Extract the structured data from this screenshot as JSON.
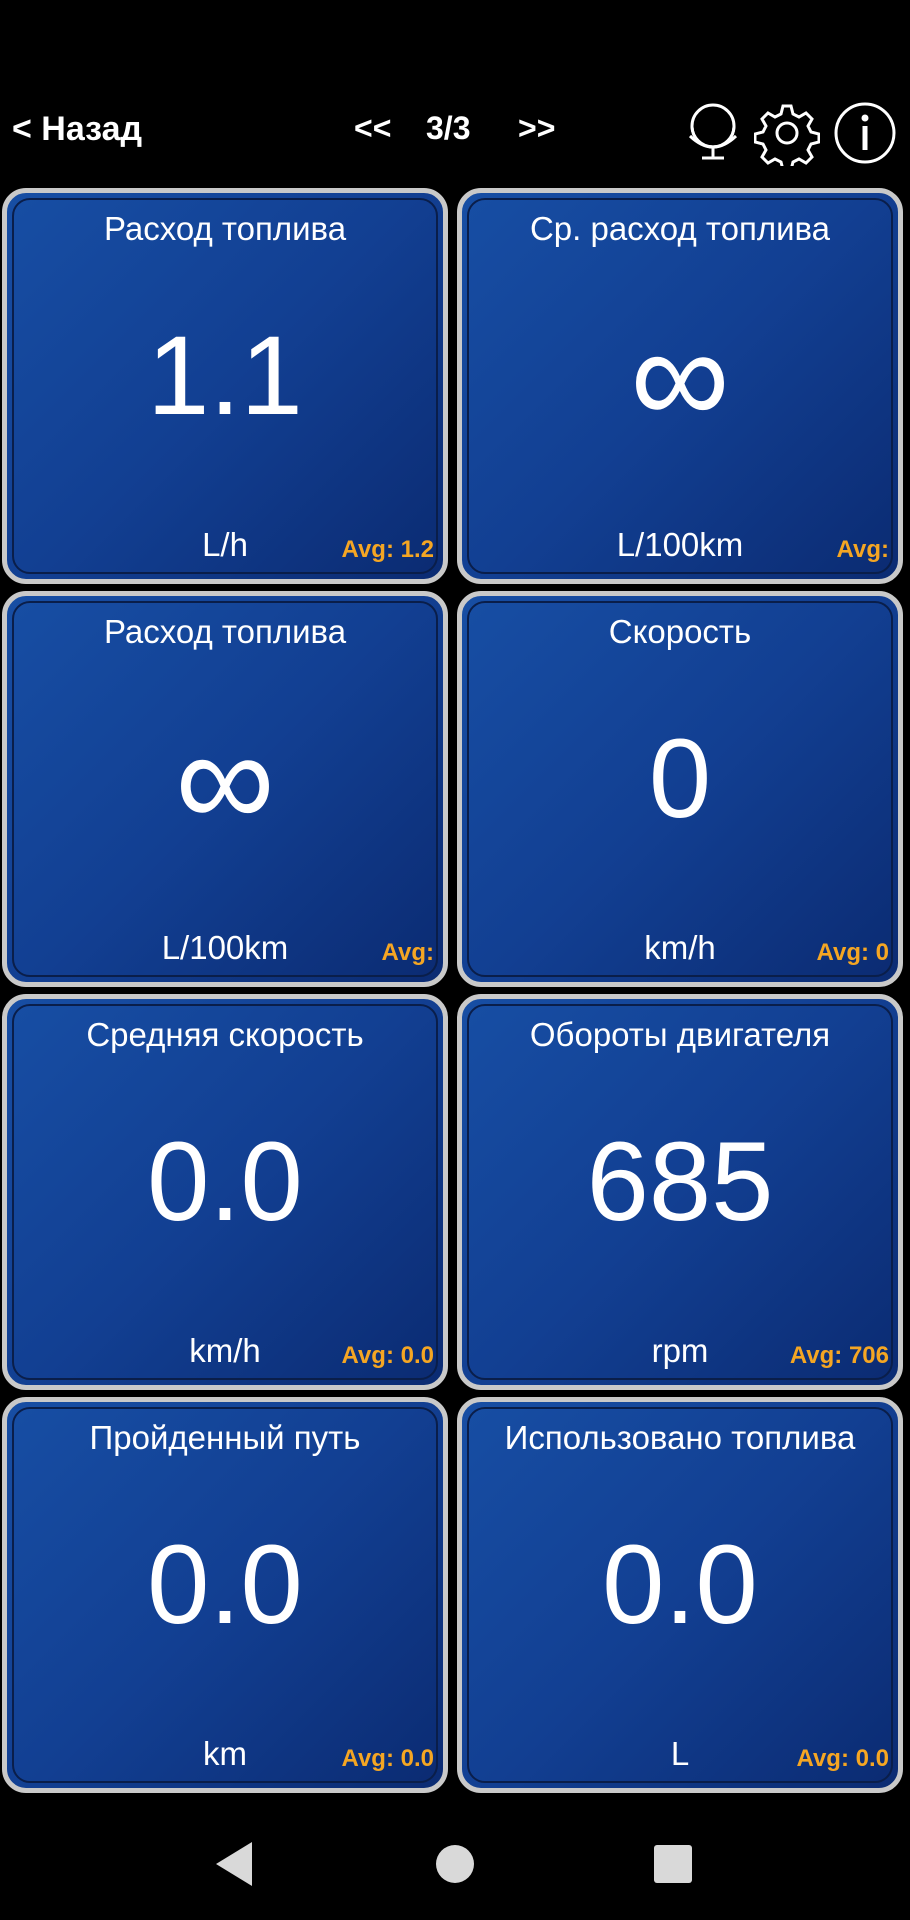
{
  "toolbar": {
    "back_label": "< Назад",
    "prev_label": "<<",
    "page_indicator": "3/3",
    "next_label": ">>",
    "icons": [
      "globe-icon",
      "gear-icon",
      "info-icon"
    ]
  },
  "tiles": [
    {
      "title": "Расход топлива",
      "value": "1.1",
      "unit": "L/h",
      "avg": "Avg: 1.2"
    },
    {
      "title": "Ср. расход топлива",
      "value": "∞",
      "unit": "L/100km",
      "avg": "Avg:"
    },
    {
      "title": "Расход топлива",
      "value": "∞",
      "unit": "L/100km",
      "avg": "Avg:"
    },
    {
      "title": "Скорость",
      "value": "0",
      "unit": "km/h",
      "avg": "Avg: 0"
    },
    {
      "title": "Средняя скорость",
      "value": "0.0",
      "unit": "km/h",
      "avg": "Avg: 0.0"
    },
    {
      "title": "Обороты двигателя",
      "value": "685",
      "unit": "rpm",
      "avg": "Avg: 706"
    },
    {
      "title": "Пройденный путь",
      "value": "0.0",
      "unit": "km",
      "avg": "Avg: 0.0"
    },
    {
      "title": "Использовано топлива",
      "value": "0.0",
      "unit": "L",
      "avg": "Avg: 0.0"
    }
  ],
  "navigation": {
    "icons": [
      "back-triangle-icon",
      "home-circle-icon",
      "recents-square-icon"
    ]
  },
  "colors": {
    "background": "#000000",
    "tile_blue": "#123f92",
    "tile_border": "#c9c9c9",
    "avg_orange": "#f5a623",
    "text": "#ffffff"
  }
}
